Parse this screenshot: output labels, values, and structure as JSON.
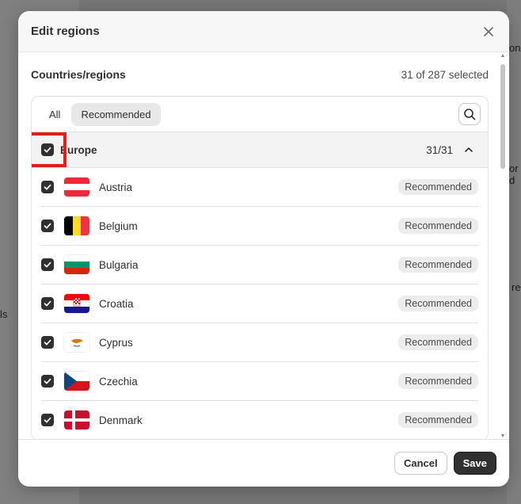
{
  "modal": {
    "title": "Edit regions",
    "close_icon": "close-icon"
  },
  "section": {
    "title": "Countries/regions",
    "selected_count": "31 of 287 selected"
  },
  "tabs": [
    {
      "label": "All",
      "active": false
    },
    {
      "label": "Recommended",
      "active": true
    }
  ],
  "search_icon": "search-icon",
  "group": {
    "name": "Europe",
    "count": "31/31",
    "checked": true,
    "expanded": true
  },
  "countries": [
    {
      "name": "Austria",
      "badge": "Recommended",
      "checked": true,
      "flag": "austria-flag-icon"
    },
    {
      "name": "Belgium",
      "badge": "Recommended",
      "checked": true,
      "flag": "belgium-flag-icon"
    },
    {
      "name": "Bulgaria",
      "badge": "Recommended",
      "checked": true,
      "flag": "bulgaria-flag-icon"
    },
    {
      "name": "Croatia",
      "badge": "Recommended",
      "checked": true,
      "flag": "croatia-flag-icon"
    },
    {
      "name": "Cyprus",
      "badge": "Recommended",
      "checked": true,
      "flag": "cyprus-flag-icon"
    },
    {
      "name": "Czechia",
      "badge": "Recommended",
      "checked": true,
      "flag": "czechia-flag-icon"
    },
    {
      "name": "Denmark",
      "badge": "Recommended",
      "checked": true,
      "flag": "denmark-flag-icon"
    }
  ],
  "footer": {
    "cancel_label": "Cancel",
    "save_label": "Save"
  },
  "background": {
    "fragment_left": "ls",
    "fragment_right_1": "on",
    "fragment_right_2": "or d",
    "fragment_right_3": "re"
  },
  "colors": {
    "primary_button": "#303030",
    "highlight": "#e01e1e"
  }
}
